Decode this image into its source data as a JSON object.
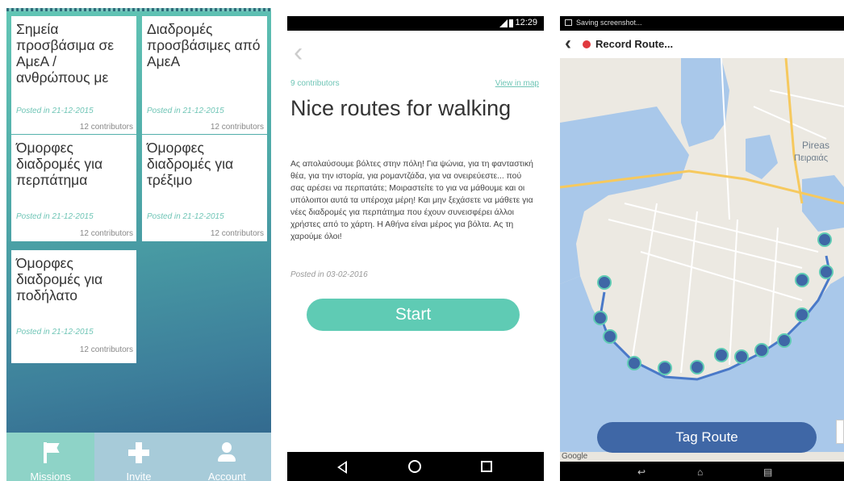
{
  "missions_screen": {
    "cards": [
      {
        "title": "Σημεία προσβάσιμα σε ΑμεΑ / ανθρώπους με",
        "date": "Posted in 21-12-2015",
        "contributors": "12 contributors"
      },
      {
        "title": "Διαδρομές προσβάσιμες από ΑμεΑ",
        "date": "Posted in 21-12-2015",
        "contributors": "12 contributors"
      },
      {
        "title": "Όμορφες διαδρομές για περπάτημα",
        "date": "Posted in 21-12-2015",
        "contributors": "12 contributors"
      },
      {
        "title": "Όμορφες διαδρομές για τρέξιμο",
        "date": "Posted in 21-12-2015",
        "contributors": "12 contributors"
      },
      {
        "title": "Όμορφες διαδρομές για ποδήλατο",
        "date": "Posted in 21-12-2015",
        "contributors": "12 contributors"
      }
    ],
    "tabs": [
      {
        "label": "Missions",
        "icon": "flag-icon",
        "active": true
      },
      {
        "label": "Invite",
        "icon": "plus-icon",
        "active": false
      },
      {
        "label": "Account",
        "icon": "person-icon",
        "active": false
      }
    ]
  },
  "route_screen": {
    "status_time": "12:29",
    "back_icon": "chevron-left-icon",
    "contributors": "9 contributors",
    "view_in_map": "View in map",
    "title": "Nice routes for walking",
    "description": "Ας απολαύσουμε βόλτες στην πόλη! Για ψώνια, για τη φανταστική θέα, για την ιστορία, για ρομαντζάδα, για να ονειρεύεστε... πού σας αρέσει να περπατάτε; Μοιραστείτε το για να μάθουμε και οι υπόλοιποι αυτά τα υπέροχα μέρη! Και μην ξεχάσετε να μάθετε για νέες διαδρομές για περπάτημα που έχουν συνεισφέρει άλλοι χρήστες από το χάρτη. Η Αθήνα είναι μέρος για βόλτα. Ας τη χαρούμε όλοι!",
    "posted": "Posted in 03-02-2016",
    "start_label": "Start"
  },
  "map_screen": {
    "status_text": "Saving screenshot...",
    "title": "Record Route...",
    "tag_route_label": "Tag Route",
    "google_label": "Google",
    "map_labels": {
      "piraeus": "Pireas",
      "piraeus_greek": "Πειραιάς"
    },
    "colors": {
      "sea": "#a9c8ea",
      "land": "#ece9e2",
      "route": "#4a79c8",
      "accent": "#5fcbb4"
    }
  }
}
